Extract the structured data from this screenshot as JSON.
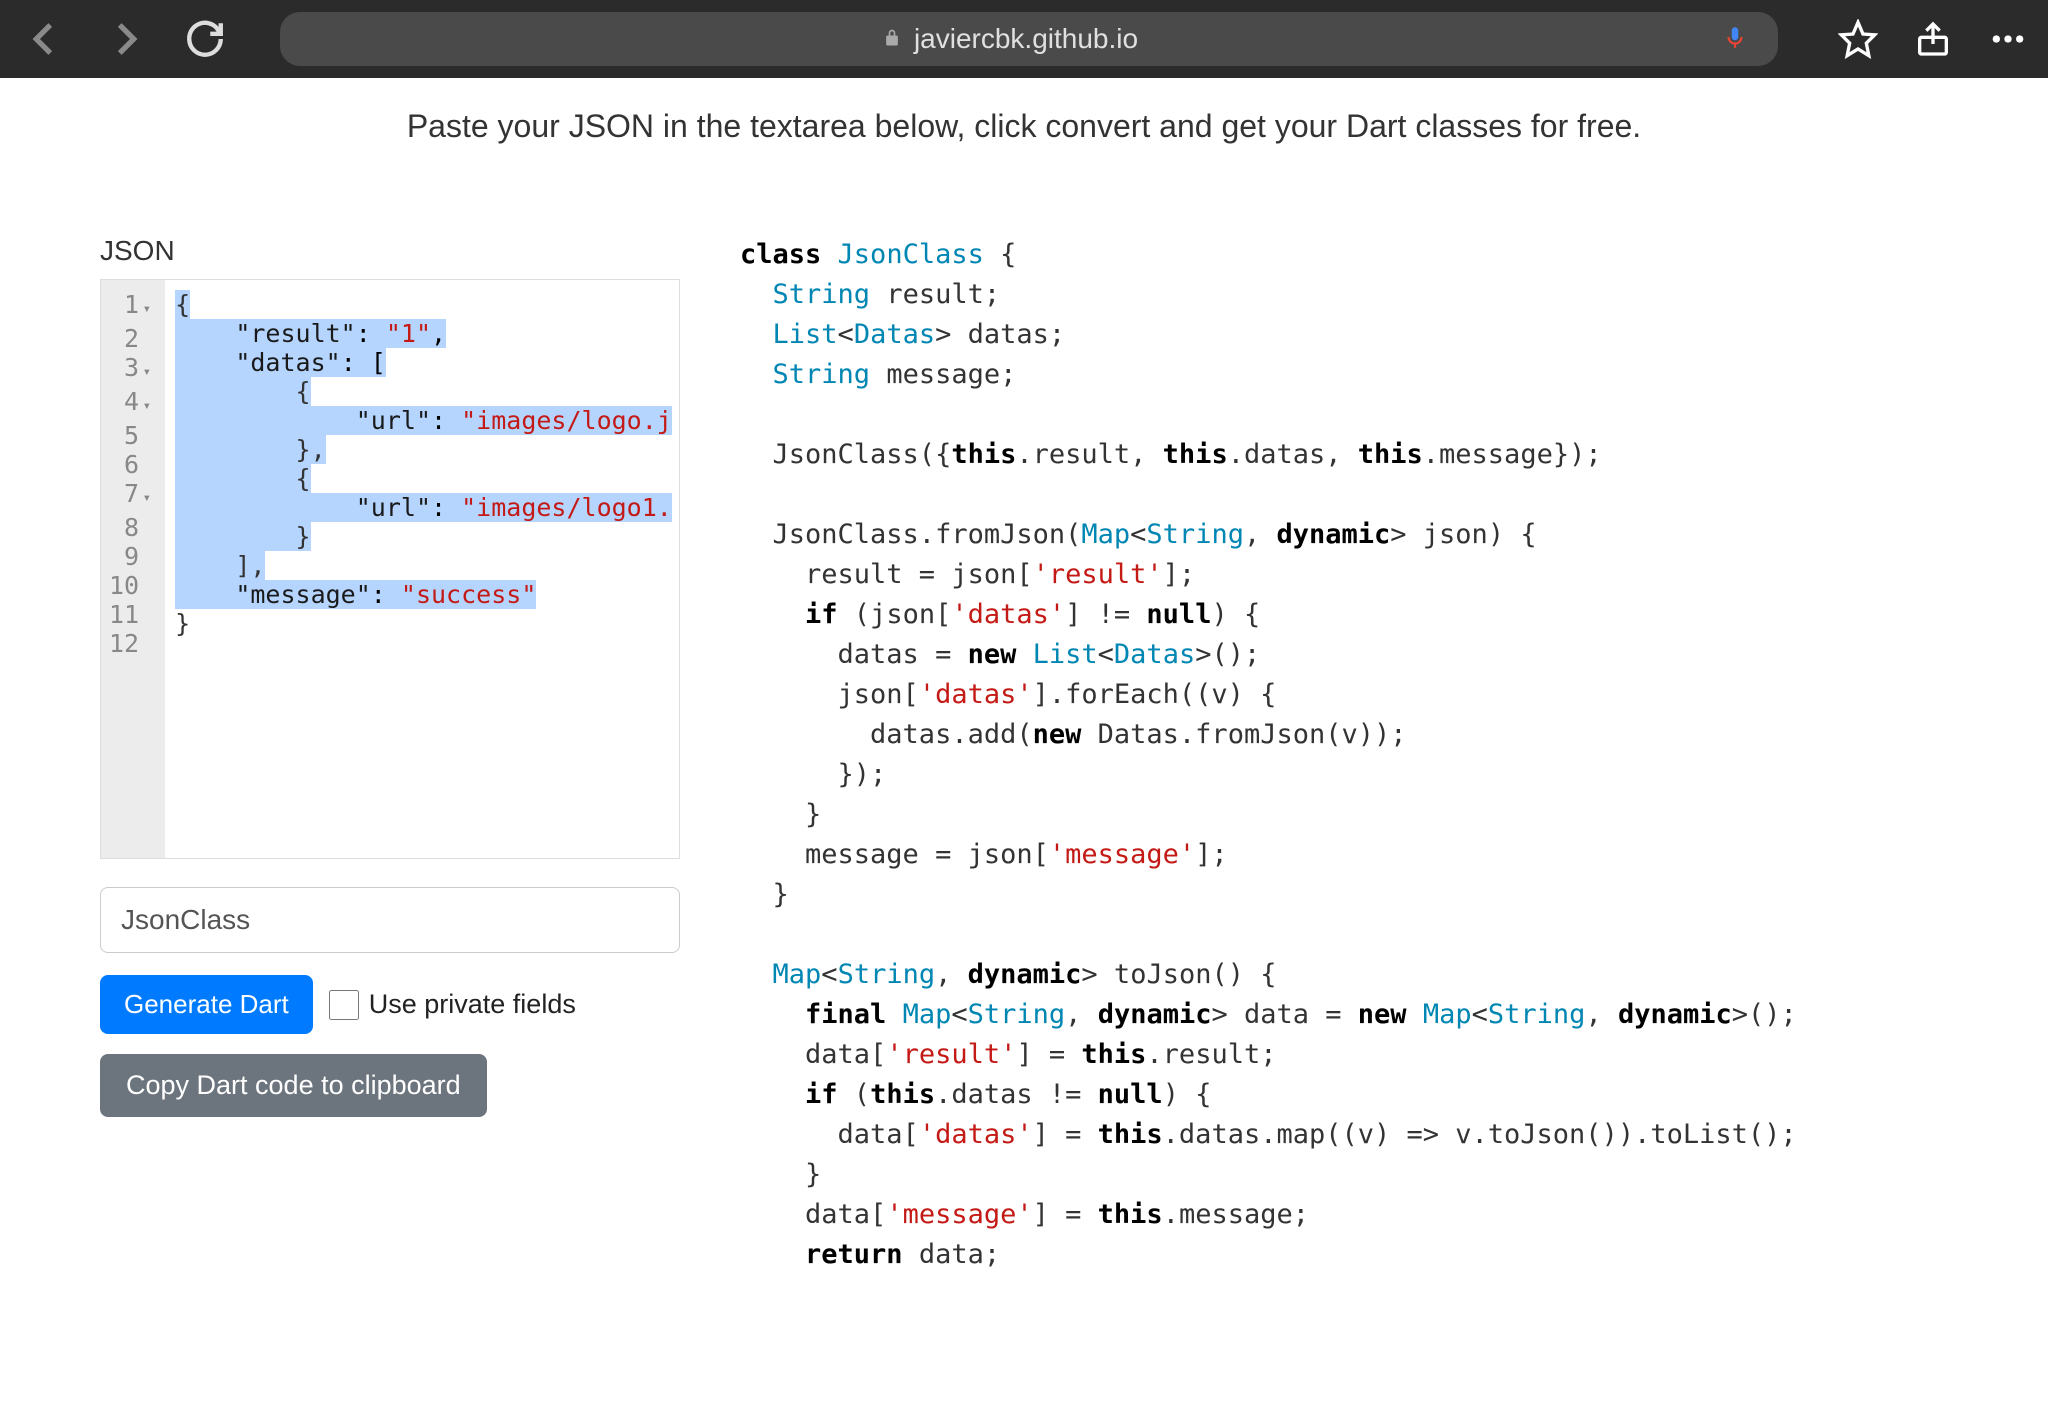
{
  "browser": {
    "url": "javiercbk.github.io"
  },
  "page": {
    "tagline": "Paste your JSON in the textarea below, click convert and get your Dart classes for free.",
    "jsonLabel": "JSON",
    "classNameInput": "JsonClass",
    "generateButton": "Generate Dart",
    "privateFieldsLabel": "Use private fields",
    "copyButton": "Copy Dart code to clipboard"
  },
  "editor": {
    "lines": [
      {
        "n": "1",
        "fold": true
      },
      {
        "n": "2"
      },
      {
        "n": "3",
        "fold": true
      },
      {
        "n": "4",
        "fold": true
      },
      {
        "n": "5"
      },
      {
        "n": "6"
      },
      {
        "n": "7",
        "fold": true
      },
      {
        "n": "8"
      },
      {
        "n": "9"
      },
      {
        "n": "10"
      },
      {
        "n": "11"
      },
      {
        "n": "12"
      }
    ],
    "json": {
      "l1": "{",
      "l2_key": "\"result\"",
      "l2_val": "\"1\"",
      "l3_key": "\"datas\"",
      "l4": "{",
      "l5_key": "\"url\"",
      "l5_val": "\"images/logo.j",
      "l6": "},",
      "l7": "{",
      "l8_key": "\"url\"",
      "l8_val": "\"images/logo1.",
      "l9": "}",
      "l10": "],",
      "l11_key": "\"message\"",
      "l11_val": "\"success\"",
      "l12": "}"
    }
  },
  "dart": {
    "l1_a": "class",
    "l1_b": "JsonClass",
    "l1_c": " {",
    "l2_a": "String",
    "l2_b": " result;",
    "l3_a": "List",
    "l3_b": "Datas",
    "l3_c": "> datas;",
    "l4_a": "String",
    "l4_b": " message;",
    "l6": "  JsonClass({",
    "l6_b": "this",
    "l6_c": ".result, ",
    "l6_d": "this",
    "l6_e": ".datas, ",
    "l6_f": "this",
    "l6_g": ".message});",
    "l8": "  JsonClass.fromJson(",
    "l8_b": "Map",
    "l8_c": "String",
    "l8_d": ", ",
    "l8_e": "dynamic",
    "l8_f": "> json) {",
    "l9": "    result = json[",
    "l9_b": "'result'",
    "l9_c": "];",
    "l10": "    ",
    "l10_b": "if",
    "l10_c": " (json[",
    "l10_d": "'datas'",
    "l10_e": "] != ",
    "l10_f": "null",
    "l10_g": ") {",
    "l11": "      datas = ",
    "l11_b": "new",
    "l11_c": " ",
    "l11_d": "List",
    "l11_e": "Datas",
    "l11_f": ">();",
    "l12": "      json[",
    "l12_b": "'datas'",
    "l12_c": "].forEach((v) {",
    "l13": "        datas.add(",
    "l13_b": "new",
    "l13_c": " Datas.fromJson(v));",
    "l14": "      });",
    "l15": "    }",
    "l16": "    message = json[",
    "l16_b": "'message'",
    "l16_c": "];",
    "l17": "  }",
    "l19": "  ",
    "l19_b": "Map",
    "l19_c": "String",
    "l19_d": ", ",
    "l19_e": "dynamic",
    "l19_f": "> toJson() {",
    "l20": "    ",
    "l20_b": "final",
    "l20_c": " ",
    "l20_d": "Map",
    "l20_e": "String",
    "l20_f": ", ",
    "l20_g": "dynamic",
    "l20_h": "> data = ",
    "l20_i": "new",
    "l20_j": " ",
    "l20_k": "Map",
    "l20_l": "String",
    "l20_m": ", ",
    "l20_n": "dynamic",
    "l20_o": ">();",
    "l21": "    data[",
    "l21_b": "'result'",
    "l21_c": "] = ",
    "l21_d": "this",
    "l21_e": ".result;",
    "l22": "    ",
    "l22_b": "if",
    "l22_c": " (",
    "l22_d": "this",
    "l22_e": ".datas != ",
    "l22_f": "null",
    "l22_g": ") {",
    "l23": "      data[",
    "l23_b": "'datas'",
    "l23_c": "] = ",
    "l23_d": "this",
    "l23_e": ".datas.map((v) => v.toJson()).toList();",
    "l24": "    }",
    "l25": "    data[",
    "l25_b": "'message'",
    "l25_c": "] = ",
    "l25_d": "this",
    "l25_e": ".message;",
    "l26": "    ",
    "l26_b": "return",
    "l26_c": " data;"
  }
}
